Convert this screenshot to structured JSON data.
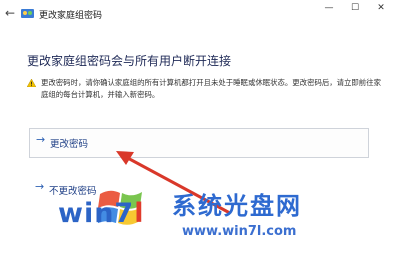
{
  "window": {
    "title": "更改家庭组密码",
    "back_glyph": "←",
    "min_glyph": "—",
    "max_glyph": "☐",
    "close_glyph": "✕"
  },
  "heading": "更改家庭组密码会与所有用户断开连接",
  "warning_text": "更改密码时，请你确认家庭组的所有计算机都打开且未处于睡眠或休眠状态。更改密码后，请立即前往家庭组的每台计算机，并输入新密码。",
  "options": [
    {
      "arrow": "→",
      "label": "更改密码"
    },
    {
      "arrow": "→",
      "label": "不更改密码"
    }
  ],
  "watermark": {
    "brand": "win7",
    "brand_suffix": "l",
    "cn": "系统光盘网",
    "url": "www.win7l.com"
  },
  "colors": {
    "accent": "#2f62b4",
    "annotation": "#d9382a"
  }
}
